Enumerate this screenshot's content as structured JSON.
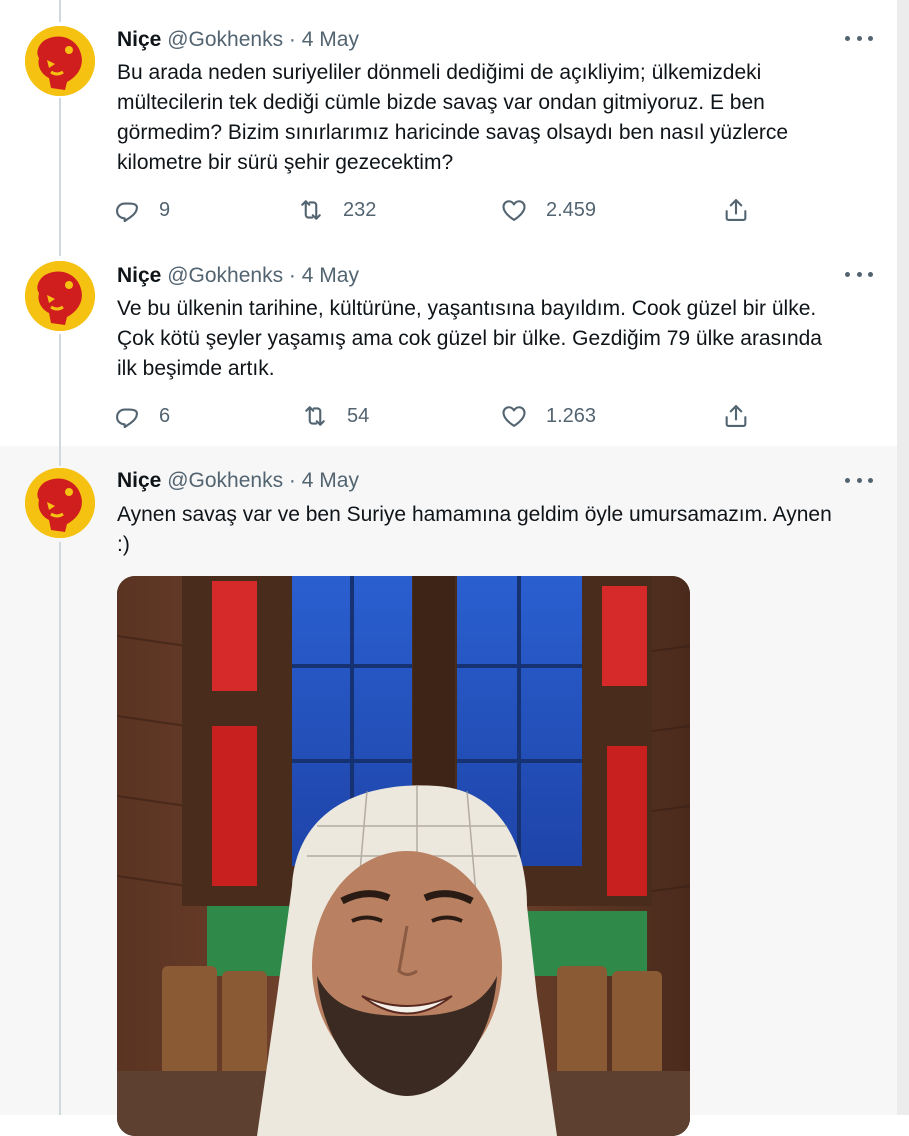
{
  "tweets": [
    {
      "name": "Niçe",
      "handle": "@Gokhenks",
      "separator": "·",
      "date": "4 May",
      "text": "Bu arada neden suriyeliler dönmeli dediğimi de açıkliyim; ülkemizdeki\nmültecilerin tek dediği cümle bizde savaş var ondan gitmiyoruz. E ben\ngörmedim? Bizim sınırlarımız haricinde savaş olsaydı ben nasıl yüzlerce\nkilometre bir sürü şehir gezecektim?",
      "replies": "9",
      "retweets": "232",
      "likes": "2.459"
    },
    {
      "name": "Niçe",
      "handle": "@Gokhenks",
      "separator": "·",
      "date": "4 May",
      "text": "Ve bu ülkenin tarihine, kültürüne, yaşantısına bayıldım. Cook güzel bir ülke.\nÇok kötü şeyler yaşamış ama cok güzel bir ülke. Gezdiğim 79 ülke arasında\nilk beşimde artık.",
      "replies": "6",
      "retweets": "54",
      "likes": "1.263"
    },
    {
      "name": "Niçe",
      "handle": "@Gokhenks",
      "separator": "·",
      "date": "4 May",
      "text": "Aynen savaş var ve ben Suriye hamamına geldim öyle umursamazım. Aynen\n:)"
    }
  ],
  "icons": {
    "reply": "reply-icon",
    "retweet": "retweet-icon",
    "like": "heart-icon",
    "share": "share-icon",
    "more": "more-icon"
  },
  "colors": {
    "text": "#0f1419",
    "secondary": "#536471",
    "thread_line": "#cfd9de",
    "avatar_bg": "#f5c211",
    "avatar_fg": "#d01e1e",
    "highlight_bg": "#f7f7f7"
  }
}
